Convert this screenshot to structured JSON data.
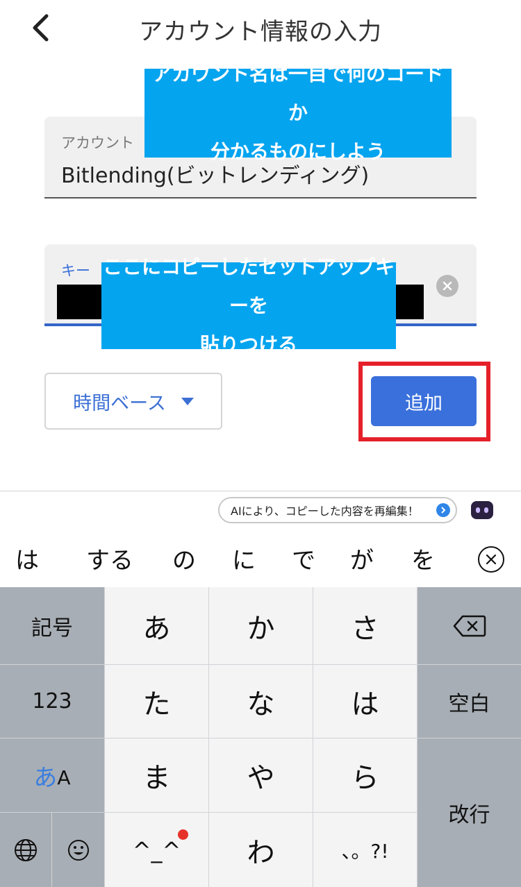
{
  "header": {
    "title": "アカウント情報の入力"
  },
  "account_field": {
    "label": "アカウント",
    "value": "Bitlending(ビットレンディング)"
  },
  "key_field": {
    "label": "キー"
  },
  "callouts": {
    "account_note_line1": "アカウント名は一目で何のコードか",
    "account_note_line2": "分かるものにしよう",
    "key_note_line1": "ここにコピーしたセットアップキーを",
    "key_note_line2": "貼りつける"
  },
  "controls": {
    "time_select": "時間ベース",
    "add_button": "追加"
  },
  "kb_toolbar": {
    "ai_suggestion": "AIにより、コピーした内容を再編集！"
  },
  "candidates": [
    "は",
    "する",
    "の",
    "に",
    "で",
    "が",
    "を"
  ],
  "keyboard": {
    "symbols": "記号",
    "numbers": "123",
    "kana_toggle_a": "あ",
    "kana_toggle_b": "A",
    "space": "空白",
    "return": "改行",
    "kana": [
      "あ",
      "か",
      "さ",
      "た",
      "な",
      "は",
      "ま",
      "や",
      "ら",
      "^_^",
      "わ",
      "、。?!"
    ]
  },
  "colors": {
    "accent": "#3a70dc",
    "callout": "#05a4ef",
    "highlight": "#e5202a"
  }
}
